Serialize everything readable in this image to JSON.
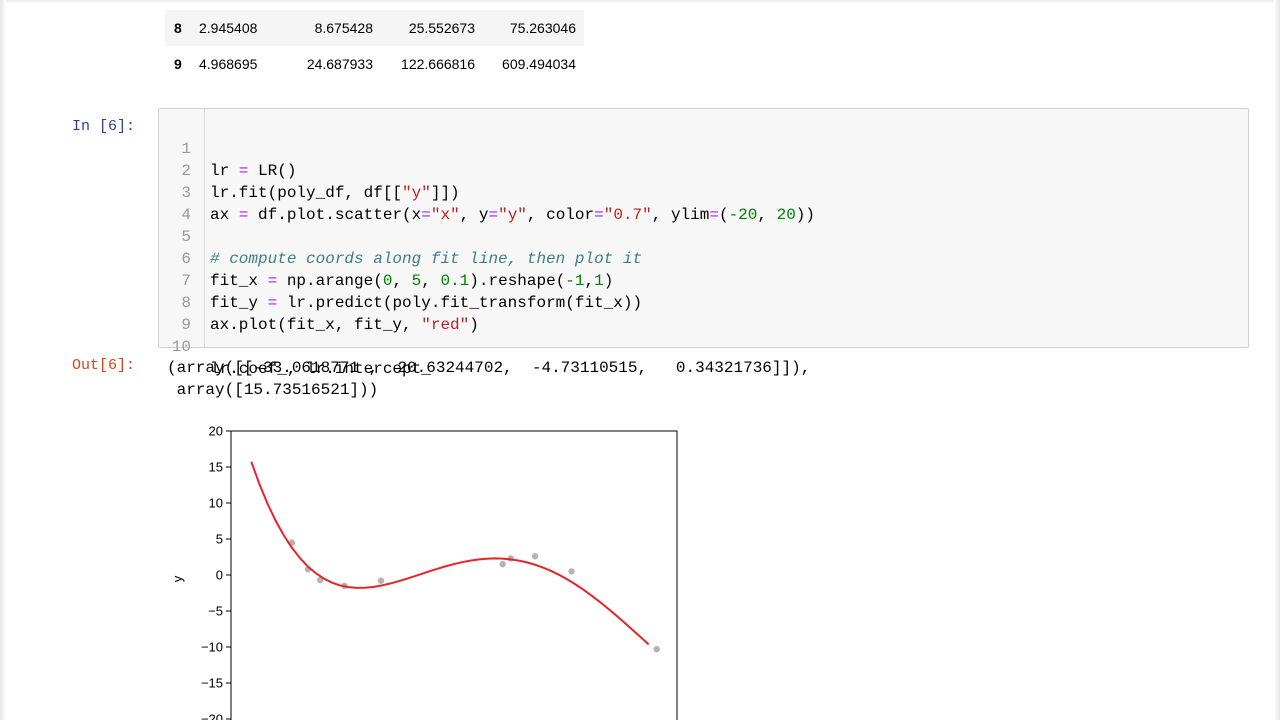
{
  "dataframe": {
    "rows": [
      {
        "index": "8",
        "values": [
          "2.945408",
          "8.675428",
          "25.552673",
          "75.263046"
        ]
      },
      {
        "index": "9",
        "values": [
          "4.968695",
          "24.687933",
          "122.666816",
          "609.494034"
        ]
      }
    ]
  },
  "cell": {
    "in_prompt": "In [6]:",
    "out_prompt": "Out[6]:",
    "line_numbers": [
      "1",
      "2",
      "3",
      "4",
      "5",
      "6",
      "7",
      "8",
      "9",
      "10"
    ],
    "lines": {
      "l1": {
        "a": "lr ",
        "op": "=",
        "b": " LR()"
      },
      "l2": {
        "a": "lr.fit(poly_df, df[[",
        "s": "\"y\"",
        "b": "]])"
      },
      "l3": {
        "a": "ax ",
        "op1": "=",
        "b": " df.plot.scatter(x",
        "op2": "=",
        "s1": "\"x\"",
        "c": ", y",
        "op3": "=",
        "s2": "\"y\"",
        "d": ", color",
        "op4": "=",
        "s3": "\"0.7\"",
        "e": ", ylim",
        "op5": "=",
        "f": "(",
        "n1": "-20",
        "g": ", ",
        "n2": "20",
        "h": "))"
      },
      "l5": {
        "comment": "# compute coords along fit line, then plot it"
      },
      "l6": {
        "a": "fit_x ",
        "op": "=",
        "b": " np.arange(",
        "n1": "0",
        "c": ", ",
        "n2": "5",
        "d": ", ",
        "n3": "0.1",
        "e": ").reshape(",
        "n4": "-1",
        "f": ",",
        "n5": "1",
        "g": ")"
      },
      "l7": {
        "a": "fit_y ",
        "op": "=",
        "b": " lr.predict(poly.fit_transform(fit_x))"
      },
      "l8": {
        "a": "ax.plot(fit_x, fit_y, ",
        "s": "\"red\"",
        "b": ")"
      },
      "l10": {
        "a": "lr.coef_, lr.intercept_"
      }
    },
    "output_lines": [
      "(array([[-33.0618771 ,  20.63244702,  -4.73110515,   0.34321736]]),",
      " array([15.73516521]))"
    ]
  },
  "chart_data": {
    "type": "scatter",
    "ylabel": "y",
    "ylim": [
      -20,
      20
    ],
    "xlim": [
      -0.25,
      5.25
    ],
    "yticks": [
      "20",
      "15",
      "10",
      "5",
      "0",
      "−5",
      "−10",
      "−15",
      "−20"
    ],
    "points": {
      "color": "#b3b3b3",
      "x": [
        0.5,
        0.7,
        0.85,
        1.15,
        1.6,
        3.1,
        3.2,
        3.5,
        3.95,
        5.0
      ],
      "y": [
        4.5,
        0.8,
        -0.7,
        -1.5,
        -0.8,
        1.5,
        2.3,
        2.6,
        0.5,
        -10.3
      ]
    },
    "fit_line": {
      "color": "#e8232a",
      "intercept": 15.73516521,
      "coef": [
        -33.0618771,
        20.63244702,
        -4.73110515,
        0.34321736
      ],
      "x_start": 0,
      "x_end": 4.9,
      "x_step": 0.1
    }
  }
}
